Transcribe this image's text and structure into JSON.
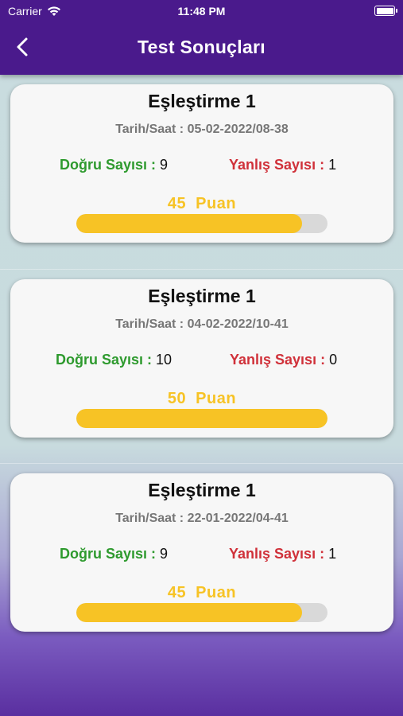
{
  "status_bar": {
    "carrier": "Carrier",
    "time": "11:48 PM"
  },
  "header": {
    "title": "Test Sonuçları"
  },
  "colors": {
    "header_bg": "#4a1a8c",
    "correct": "#2e9a2e",
    "wrong": "#d0313a",
    "score": "#f7c325"
  },
  "results": [
    {
      "title": "Eşleştirme 1",
      "datetime": "Tarih/Saat : 05-02-2022/08-38",
      "correct_label": "Doğru Sayısı :",
      "correct_value": "9",
      "wrong_label": "Yanlış Sayısı :",
      "wrong_value": "1",
      "score_value": "45",
      "score_unit": "Puan",
      "progress": 0.9
    },
    {
      "title": "Eşleştirme 1",
      "datetime": "Tarih/Saat : 04-02-2022/10-41",
      "correct_label": "Doğru Sayısı :",
      "correct_value": "10",
      "wrong_label": "Yanlış Sayısı :",
      "wrong_value": "0",
      "score_value": "50",
      "score_unit": "Puan",
      "progress": 1.0
    },
    {
      "title": "Eşleştirme 1",
      "datetime": "Tarih/Saat : 22-01-2022/04-41",
      "correct_label": "Doğru Sayısı :",
      "correct_value": "9",
      "wrong_label": "Yanlış Sayısı :",
      "wrong_value": "1",
      "score_value": "45",
      "score_unit": "Puan",
      "progress": 0.9
    }
  ]
}
